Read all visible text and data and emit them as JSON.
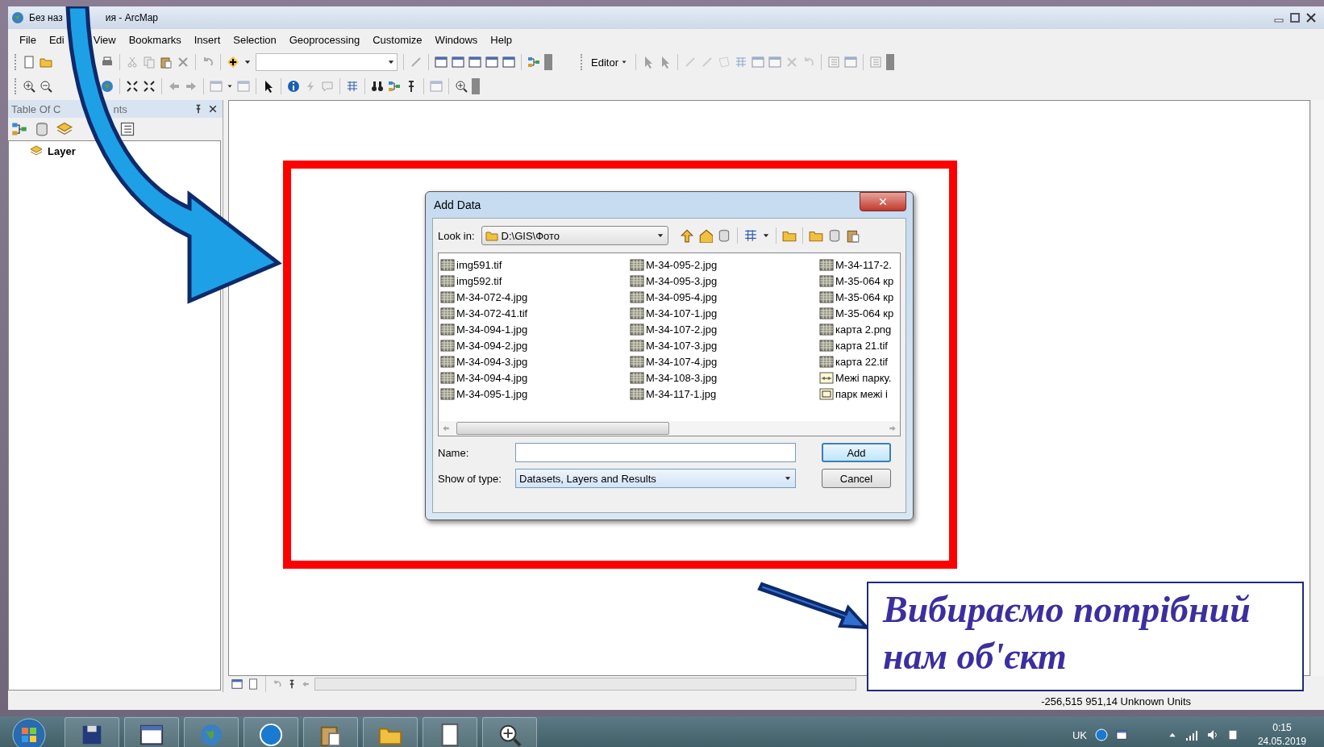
{
  "window": {
    "title_parts": [
      "Без наз",
      "ия - ArcMap"
    ]
  },
  "menu": [
    "File",
    "Edi",
    "View",
    "Bookmarks",
    "Insert",
    "Selection",
    "Geoprocessing",
    "Customize",
    "Windows",
    "Help"
  ],
  "editor_toolbar": {
    "label": "Editor"
  },
  "toc": {
    "title_parts": [
      "Table Of C",
      "nts"
    ],
    "layers": [
      {
        "label": "Layer"
      }
    ]
  },
  "dialog": {
    "title": "Add Data",
    "look_in_label": "Look in:",
    "look_in_value": "D:\\GIS\\Фото",
    "files": [
      {
        "name": "img591.tif",
        "kind": "raster"
      },
      {
        "name": "img592.tif",
        "kind": "raster"
      },
      {
        "name": "M-34-072-4.jpg",
        "kind": "raster"
      },
      {
        "name": "M-34-072-41.tif",
        "kind": "raster"
      },
      {
        "name": "M-34-094-1.jpg",
        "kind": "raster"
      },
      {
        "name": "M-34-094-2.jpg",
        "kind": "raster"
      },
      {
        "name": "M-34-094-3.jpg",
        "kind": "raster"
      },
      {
        "name": "M-34-094-4.jpg",
        "kind": "raster"
      },
      {
        "name": "M-34-095-1.jpg",
        "kind": "raster"
      },
      {
        "name": "M-34-095-2.jpg",
        "kind": "raster"
      },
      {
        "name": "M-34-095-3.jpg",
        "kind": "raster"
      },
      {
        "name": "M-34-095-4.jpg",
        "kind": "raster"
      },
      {
        "name": "M-34-107-1.jpg",
        "kind": "raster"
      },
      {
        "name": "M-34-107-2.jpg",
        "kind": "raster"
      },
      {
        "name": "M-34-107-3.jpg",
        "kind": "raster"
      },
      {
        "name": "M-34-107-4.jpg",
        "kind": "raster"
      },
      {
        "name": "M-34-108-3.jpg",
        "kind": "raster"
      },
      {
        "name": "M-34-117-1.jpg",
        "kind": "raster"
      },
      {
        "name": "M-34-117-2.",
        "kind": "raster"
      },
      {
        "name": "M-35-064 кр",
        "kind": "raster"
      },
      {
        "name": "M-35-064 кр",
        "kind": "raster"
      },
      {
        "name": "M-35-064 кр",
        "kind": "raster"
      },
      {
        "name": "карта 2.png",
        "kind": "raster"
      },
      {
        "name": "карта 21.tif",
        "kind": "raster"
      },
      {
        "name": "карта 22.tif",
        "kind": "raster"
      },
      {
        "name": "Межі парку.",
        "kind": "layer"
      },
      {
        "name": "парк межі і",
        "kind": "map"
      }
    ],
    "name_label": "Name:",
    "type_label": "Show of type:",
    "type_value": "Datasets, Layers and Results",
    "buttons": [
      "Add",
      "Cancel"
    ]
  },
  "callout": {
    "text": "Вибираємо потрібний нам об'єкт"
  },
  "status_bar": {
    "coordinates": "-256,515  951,14 Unknown Units"
  },
  "taskbar": {
    "language": "UK",
    "time": "0:15",
    "date": "24.05.2019"
  }
}
